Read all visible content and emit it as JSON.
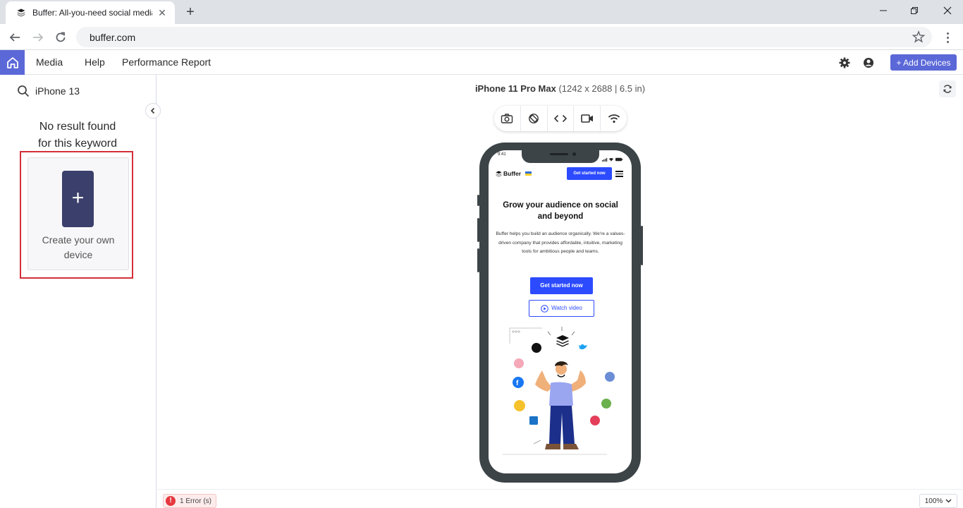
{
  "browser": {
    "tab_title": "Buffer: All-you-need social media",
    "url": "buffer.com"
  },
  "header": {
    "menu": [
      "Media",
      "Help",
      "Performance Report"
    ],
    "add_devices_label": "+ Add Devices",
    "accent_color": "#5b68d8"
  },
  "sidebar": {
    "search_value": "iPhone 13",
    "no_result_line1": "No result found",
    "no_result_line2": "for this keyword",
    "create_device_line1": "Create your own",
    "create_device_line2": "device",
    "create_device_symbol": "+"
  },
  "main": {
    "device_name": "iPhone 11 Pro Max",
    "device_specs": "(1242 x 2688 | 6.5 in)",
    "toolbar_icons": [
      "camera-icon",
      "rotate-icon",
      "code-icon",
      "video-icon",
      "wifi-icon"
    ]
  },
  "phone_screen": {
    "status_time": "9:41",
    "logo": "Buffer",
    "nav_cta": "Get started now",
    "headline": "Grow your audience on social and beyond",
    "body": "Buffer helps you build an audience organically. We're a values-driven company that provides affordable, intuitive, marketing tools for ambitious people and teams.",
    "primary_cta": "Get started now",
    "secondary_cta": "Watch video"
  },
  "footer": {
    "error_count": "1 Error (s)",
    "error_symbol": "!",
    "zoom": "100%"
  }
}
